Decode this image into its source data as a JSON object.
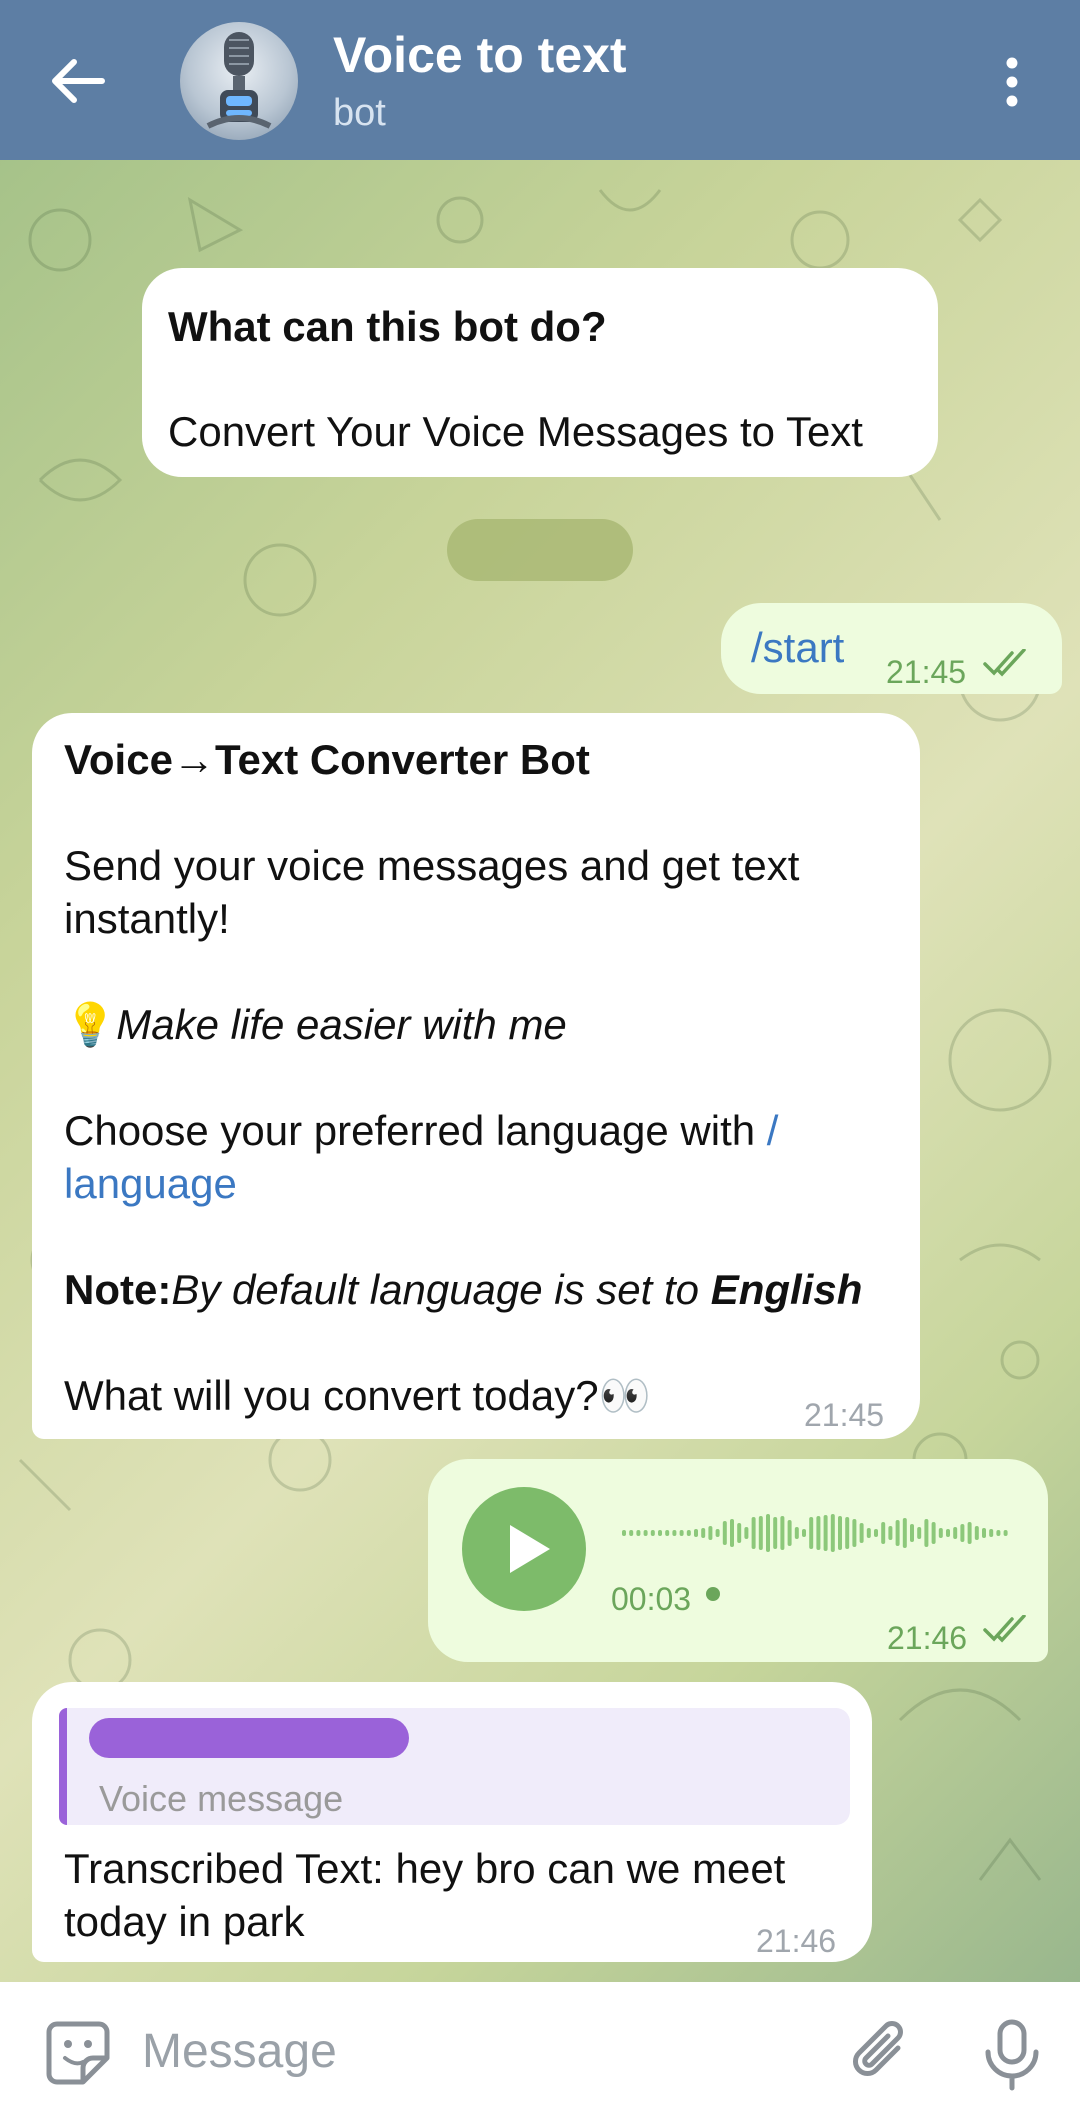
{
  "header": {
    "title": "Voice to text",
    "subtitle": "bot",
    "icons": {
      "back": "arrow-left-icon",
      "more": "more-vertical-icon",
      "avatar": "robot-microphone-avatar"
    }
  },
  "intro": {
    "title": "What can this bot do?",
    "text": "Convert Your Voice Messages to Text"
  },
  "messages": {
    "start": {
      "text": "/start",
      "time": "21:45",
      "status": "read-double-check"
    },
    "welcome": {
      "title": "Voice→Text Converter Bot",
      "line1a": " Send your voice messages and get text",
      "line1b": "instantly!",
      "tip_emoji": "💡",
      "tip": "Make life easier with me",
      "choose": " Choose your preferred language with ",
      "cmd_a": "/",
      "cmd_b": "language",
      "note_label": " Note:",
      "note_text": "By default language is set to ",
      "note_lang": "English",
      "question": " What will you convert today?",
      "question_emoji": "👀",
      "time": "21:45"
    },
    "voice": {
      "duration": "00:03",
      "time": "21:46",
      "status": "read-double-check"
    },
    "reply": {
      "quote_label": "Voice message",
      "line1": "Transcribed Text: hey bro can we meet",
      "line2": "today in park",
      "time": "21:46"
    }
  },
  "input": {
    "placeholder": "Message",
    "icons": {
      "sticker": "sticker-icon",
      "attach": "paperclip-icon",
      "mic": "microphone-icon"
    }
  },
  "colors": {
    "header": "#5d7ea4",
    "outgoing": "#eefcde",
    "accent": "#6ba65b",
    "link": "#3b78c2",
    "quote": "#9a62d9"
  }
}
